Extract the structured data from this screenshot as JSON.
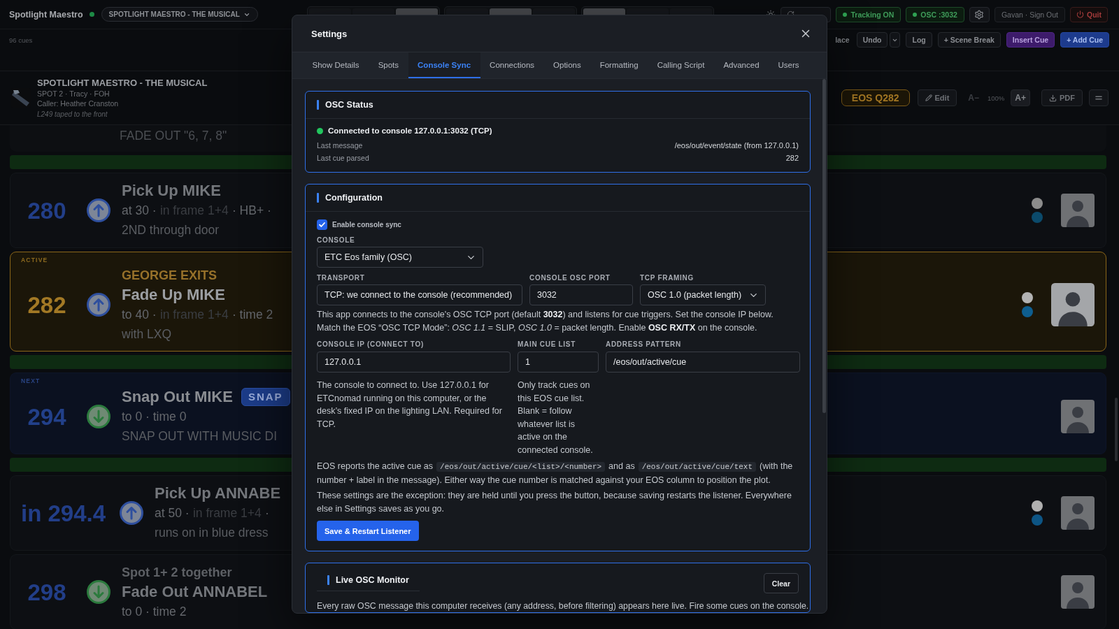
{
  "top_bar": {
    "app_name": "Spotlight Maestro",
    "show_menu": "SPOTLIGHT MAESTRO - THE MUSICAL",
    "view_groups": [
      {
        "segments": [
          {
            "selected": false
          },
          {
            "selected": false
          },
          {
            "selected": true
          }
        ]
      },
      {
        "segments": [
          {
            "selected": false
          },
          {
            "selected": true
          },
          {
            "selected": false
          }
        ]
      },
      {
        "segments": [
          {
            "selected": true
          },
          {
            "selected": false
          },
          {
            "selected": false
          }
        ]
      }
    ],
    "tracking": "Tracking ON",
    "osc": "OSC :3032",
    "account": "Gavan · Sign Out",
    "quit": "Quit"
  },
  "toolbar": {
    "cue_count": "96 cues",
    "buttons": [
      {
        "kind": "plain",
        "label": "lace"
      },
      {
        "kind": "outline",
        "label": "Undo"
      },
      {
        "kind": "menu"
      },
      {
        "kind": "outline",
        "label": "Log"
      },
      {
        "kind": "outline",
        "label": "+ Scene Break"
      },
      {
        "kind": "accent",
        "label": "Insert Cue"
      },
      {
        "kind": "primary",
        "label": "+ Add Cue"
      }
    ]
  },
  "show": {
    "title": "SPOTLIGHT MAESTRO - THE MUSICAL",
    "details": "SPOT 2 · Tracy · FOH",
    "caller": "Caller: Heather Cranston",
    "note": "L249 taped to the front",
    "eos_cue": "EOS Q282",
    "edit": "Edit",
    "text_smaller": "A−",
    "text_size": "100%",
    "text_larger": "A+",
    "export": "PDF"
  },
  "cues": [
    {
      "kind": "tail",
      "note": "FADE OUT \"6, 7, 8\""
    },
    {
      "kind": "break"
    },
    {
      "kind": "up",
      "active": false,
      "next": false,
      "number": "280",
      "title": "Pick Up MIKE",
      "detail": [
        {
          "kind": "plain",
          "text": "at 30 ·"
        },
        {
          "kind": "muted",
          "text": "in frame 1+4"
        },
        {
          "kind": "plain",
          "text": "· HB+ ·"
        }
      ],
      "note": "2ND through door",
      "dots": [
        {
          "color": "#8c8c8c"
        },
        {
          "color": "#0b4a6b"
        }
      ]
    },
    {
      "kind": "up",
      "active": true,
      "next": false,
      "status_label": "ACTIVE",
      "number": "282",
      "heading": "GEORGE EXITS",
      "title": "Fade Up MIKE",
      "detail": [
        {
          "kind": "plain",
          "text": "to 40 ·"
        },
        {
          "kind": "muted",
          "text": "in frame 1+4"
        },
        {
          "kind": "plain",
          "text": "· time 2"
        }
      ],
      "note": "with LXQ",
      "dots": [
        {
          "color": "#b3b3b3"
        },
        {
          "color": "#0e5e90"
        }
      ]
    },
    {
      "kind": "break"
    },
    {
      "kind": "down",
      "active": false,
      "next": true,
      "status_label": "NEXT",
      "number": "294",
      "title": "Snap Out MIKE",
      "badge": "SNAP",
      "detail": [
        {
          "kind": "plain",
          "text": "to 0 · time 0"
        }
      ],
      "note": "SNAP OUT WITH MUSIC DI"
    },
    {
      "kind": "break"
    },
    {
      "kind": "up",
      "active": false,
      "next": false,
      "number": "in 294.4",
      "title": "Pick Up ANNABE",
      "detail": [
        {
          "kind": "plain",
          "text": "at 50 ·"
        },
        {
          "kind": "muted",
          "text": "in frame 1+4"
        },
        {
          "kind": "plain",
          "text": "·"
        }
      ],
      "note": "runs on in blue dress",
      "dots": [
        {
          "color": "#b0b0b0"
        },
        {
          "color": "#0d5585"
        }
      ]
    },
    {
      "kind": "down",
      "active": false,
      "next": false,
      "number": "298",
      "heading": "Spot 1+ 2 together",
      "title": "Fade Out ANNABEL",
      "detail": [
        {
          "kind": "plain",
          "text": "to 0 · time 2"
        }
      ]
    }
  ],
  "settings": {
    "title": "Settings",
    "tabs": [
      {
        "label": "Show Details",
        "selected": false
      },
      {
        "label": "Spots",
        "selected": false
      },
      {
        "label": "Console Sync",
        "selected": true
      },
      {
        "label": "Connections",
        "selected": false
      },
      {
        "label": "Options",
        "selected": false
      },
      {
        "label": "Formatting",
        "selected": false
      },
      {
        "label": "Calling Script",
        "selected": false
      },
      {
        "label": "Advanced",
        "selected": false
      },
      {
        "label": "Users",
        "selected": false
      }
    ],
    "osc_status": {
      "title": "OSC Status",
      "connected": true,
      "status": "Connected to console 127.0.0.1:3032 (TCP)",
      "rows": [
        {
          "label": "Last message",
          "value": "/eos/out/event/state (from 127.0.0.1)"
        },
        {
          "label": "Last cue parsed",
          "value": "282"
        }
      ]
    },
    "configuration": {
      "title": "Configuration",
      "enable_sync": {
        "label": "Enable console sync",
        "checked": true
      },
      "console": {
        "label": "CONSOLE",
        "value": "ETC Eos family (OSC)"
      },
      "transport": {
        "label": "TRANSPORT",
        "value": "TCP: we connect to the console (recommended)"
      },
      "port": {
        "label": "CONSOLE OSC PORT",
        "value": "3032"
      },
      "framing": {
        "label": "TCP FRAMING",
        "value": "OSC 1.0 (packet length)"
      },
      "transport_note": "This app connects to the console's OSC TCP port (default **3032**) and listens for cue triggers. Set the console IP below. Match the EOS “OSC TCP Mode”: *OSC 1.1* = SLIP, *OSC 1.0* = packet length. Enable **OSC RX/TX** on the console.",
      "console_ip": {
        "label": "CONSOLE IP (CONNECT TO)",
        "value": "127.0.0.1",
        "hint": "The console to connect to. Use 127.0.0.1 for ETCnomad running on this computer, or the desk’s fixed IP on the lighting LAN. Required for TCP."
      },
      "cue_list": {
        "label": "MAIN CUE LIST",
        "value": "1",
        "hint": "Only track cues on this EOS cue list. Blank = follow whatever list is active on the connected console."
      },
      "address_pattern": {
        "label": "ADDRESS PATTERN",
        "value": "/eos/out/active/cue"
      },
      "eos_note": [
        {
          "kind": "text",
          "text": "EOS reports the active cue as"
        },
        {
          "kind": "code",
          "text": "/eos/out/active/cue/<list>/<number>"
        },
        {
          "kind": "text",
          "text": "and as"
        },
        {
          "kind": "code",
          "text": "/eos/out/active/cue/text"
        },
        {
          "kind": "text",
          "text": "(with the number + label in the message). Either way the cue number is matched against your EOS column to position the plot."
        }
      ],
      "save_note": "These settings are the exception: they are held until you press the button, because saving restarts the listener. Everywhere else in Settings saves as you go.",
      "save_button": "Save & Restart Listener"
    },
    "live_monitor": {
      "title": "Live OSC Monitor",
      "clear": "Clear",
      "description": "Every raw OSC message this computer receives (any address, before filtering) appears here live. Fire some cues on the console."
    }
  }
}
